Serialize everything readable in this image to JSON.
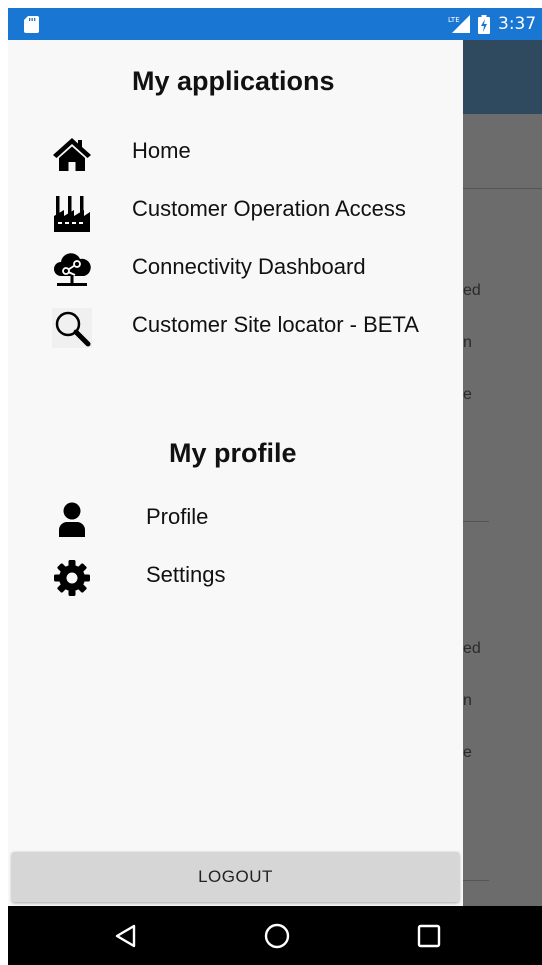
{
  "status_bar": {
    "network": "LTE",
    "time": "3:37"
  },
  "background_app": {
    "fragments": [
      "ed",
      "n",
      "e",
      "ed",
      "n",
      "e"
    ]
  },
  "drawer": {
    "applications_title": "My applications",
    "applications": [
      {
        "label": "Home",
        "icon": "home-icon"
      },
      {
        "label": "Customer Operation Access",
        "icon": "factory-icon"
      },
      {
        "label": "Connectivity Dashboard",
        "icon": "cloud-network-icon"
      },
      {
        "label": "Customer Site locator - BETA",
        "icon": "magnifier-icon"
      }
    ],
    "profile_title": "My profile",
    "profile_items": [
      {
        "label": "Profile",
        "icon": "person-icon"
      },
      {
        "label": "Settings",
        "icon": "gear-icon"
      }
    ],
    "logout_label": "LOGOUT"
  },
  "navigation_bar": {
    "buttons": [
      "back-icon",
      "home-circle-icon",
      "recents-square-icon"
    ]
  },
  "colors": {
    "status_bar": "#1976d2",
    "toolbar_dimmed": "#2f4a5f",
    "drawer_background": "#f8f8f8",
    "logout_button": "#d6d6d6"
  }
}
